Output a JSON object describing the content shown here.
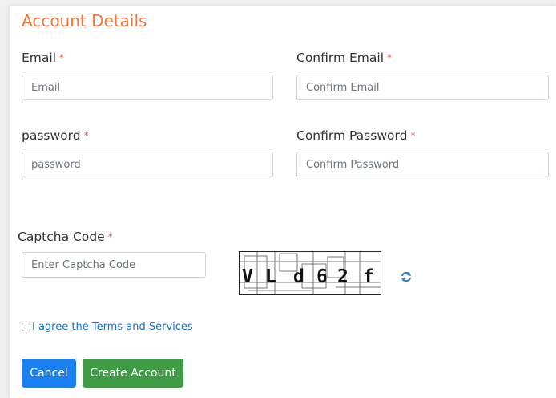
{
  "form": {
    "title": "Account Details",
    "required_marker": "*",
    "email": {
      "label": "Email",
      "placeholder": "Email",
      "value": ""
    },
    "confirm_email": {
      "label": "Confirm Email",
      "placeholder": "Confirm Email",
      "value": ""
    },
    "password": {
      "label": "password",
      "placeholder": "password",
      "value": ""
    },
    "confirm_password": {
      "label": "Confirm Password",
      "placeholder": "Confirm Password",
      "value": ""
    },
    "captcha": {
      "label": "Captcha Code",
      "placeholder": "Enter Captcha Code",
      "value": "",
      "image_text": "VLd62f",
      "refresh_icon": "refresh-icon"
    },
    "terms": {
      "label": "I agree the Terms and Services",
      "checked": false
    },
    "buttons": {
      "cancel": "Cancel",
      "create": "Create Account"
    }
  },
  "colors": {
    "title": "#f4763c",
    "required": "#e05a4f",
    "link": "#1a73c8",
    "cancel_button": "#1a7ff0",
    "create_button": "#3e9c45",
    "refresh_icon": "#2b7fd6"
  }
}
